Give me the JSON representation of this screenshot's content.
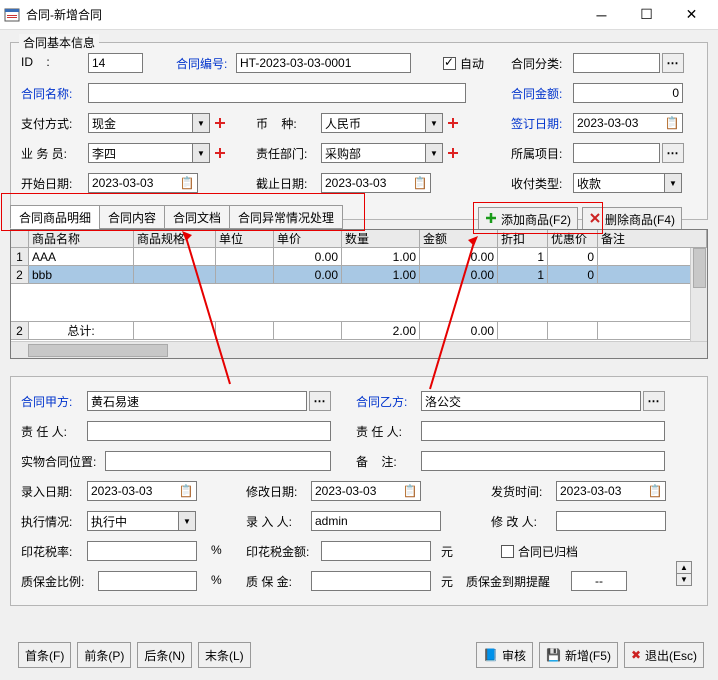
{
  "window": {
    "title": "合同-新增合同"
  },
  "section_basic": "合同基本信息",
  "labels": {
    "id": "ID    :",
    "contract_no": "合同编号:",
    "auto": "自动",
    "category": "合同分类:",
    "name": "合同名称:",
    "amount": "合同金额:",
    "pay_method": "支付方式:",
    "currency": "币    种:",
    "sign_date": "签订日期:",
    "salesman": "业 务 员:",
    "dept": "责任部门:",
    "project": "所属项目:",
    "start_date": "开始日期:",
    "end_date": "截止日期:",
    "receipt_type": "收付类型:",
    "party_a": "合同甲方:",
    "party_b": "合同乙方:",
    "person_a": "责 任 人:",
    "person_b": "责 任 人:",
    "physical": "实物合同位置:",
    "remark": "备    注:",
    "entry_date": "录入日期:",
    "modify_date": "修改日期:",
    "ship_date": "发货时间:",
    "exec_status": "执行情况:",
    "entry_by": "录 入 人:",
    "modify_by": "修 改 人:",
    "tax_rate": "印花税率:",
    "tax_amount": "印花税金额:",
    "archived": "合同已归档",
    "deposit_rate": "质保金比例:",
    "deposit_amount": "质 保 金:",
    "deposit_remind": "质保金到期提醒",
    "pct": "%",
    "yuan": "元"
  },
  "values": {
    "id": "14",
    "contract_no": "HT-2023-03-03-0001",
    "auto_checked": true,
    "category": "",
    "name": "",
    "amount": "0",
    "pay_method": "现金",
    "currency": "人民币",
    "sign_date": "2023-03-03",
    "salesman": "李四",
    "dept": "采购部",
    "project": "",
    "start_date": "2023-03-03",
    "end_date": "2023-03-03",
    "receipt_type": "收款",
    "party_a": "黄石易速",
    "party_b": "洛公交",
    "person_a": "",
    "person_b": "",
    "physical": "",
    "remark": "",
    "entry_date": "2023-03-03",
    "modify_date": "2023-03-03",
    "ship_date": "2023-03-03",
    "exec_status": "执行中",
    "entry_by": "admin",
    "modify_by": "",
    "tax_rate": "",
    "tax_amount": "",
    "archived_checked": false,
    "deposit_rate": "",
    "deposit_amount": "",
    "deposit_remind": "--"
  },
  "tabs": [
    "合同商品明细",
    "合同内容",
    "合同文档",
    "合同异常情况处理"
  ],
  "buttons": {
    "add_product": "添加商品(F2)",
    "del_product": "删除商品(F4)",
    "first": "首条(F)",
    "prev": "前条(P)",
    "next": "后条(N)",
    "last": "末条(L)",
    "audit": "审核",
    "new": "新增(F5)",
    "exit": "退出(Esc)"
  },
  "table": {
    "headers": [
      "商品名称",
      "商品规格",
      "单位",
      "单价",
      "数量",
      "金额",
      "折扣",
      "优惠价",
      "备注"
    ],
    "rows": [
      {
        "n": "1",
        "name": "AAA",
        "spec": "",
        "unit": "",
        "price": "0.00",
        "qty": "1.00",
        "amt": "0.00",
        "disc": "1",
        "promo": "0",
        "note": ""
      },
      {
        "n": "2",
        "name": "bbb",
        "spec": "",
        "unit": "",
        "price": "0.00",
        "qty": "1.00",
        "amt": "0.00",
        "disc": "1",
        "promo": "0",
        "note": ""
      }
    ],
    "total_row": {
      "n": "2",
      "label": "总计:",
      "qty": "2.00",
      "amt": "0.00"
    }
  }
}
